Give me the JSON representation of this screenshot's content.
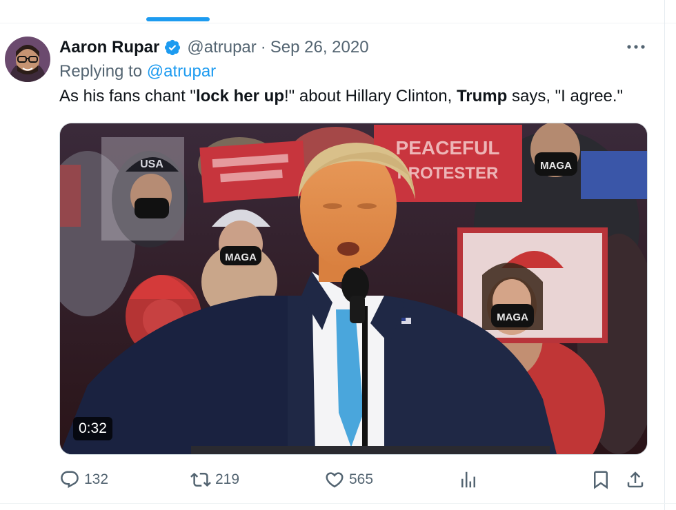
{
  "tweet": {
    "display_name": "Aaron Rupar",
    "handle": "@atrupar",
    "separator": "·",
    "date": "Sep 26, 2020",
    "replying_prefix": "Replying to",
    "replying_handle": "@atrupar",
    "text": {
      "p1": "As his fans chant \"",
      "b1": "lock her up",
      "p2": "!\" about Hillary Clinton, ",
      "b2": "Trump",
      "p3": " says, \"I agree.\""
    },
    "media": {
      "duration": "0:32",
      "sign_peaceful_1": "PEACEFUL",
      "sign_peaceful_2": "PROTESTER",
      "cap_text": "USA",
      "mask_text": "MAGA"
    }
  },
  "actions": {
    "replies": "132",
    "reposts": "219",
    "likes": "565"
  },
  "colors": {
    "accent": "#1d9bf0",
    "secondary_text": "#536471",
    "primary_text": "#0f1419"
  },
  "icons": [
    "verified-badge-icon",
    "more-icon",
    "reply-icon",
    "repost-icon",
    "like-icon",
    "views-icon",
    "bookmark-icon",
    "share-icon"
  ]
}
